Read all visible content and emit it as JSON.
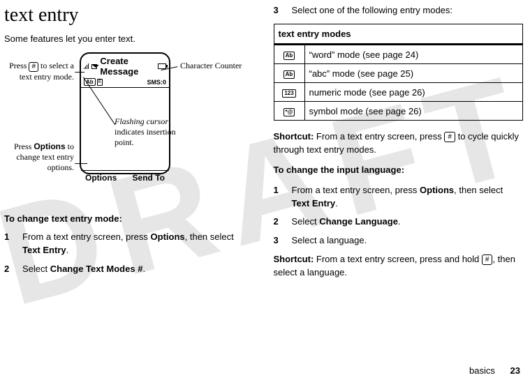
{
  "watermark": "DRAFT",
  "left": {
    "title": "text entry",
    "intro": "Some features let you enter text.",
    "phone": {
      "header": "Create Message",
      "ab_indicator": "Ab",
      "sms": "SMS:0",
      "soft_left": "Options",
      "soft_right": "Send To"
    },
    "annot": {
      "left1_a": "Press ",
      "left1_key": "#",
      "left1_b": " to select a text entry mode.",
      "left2_a": "Press ",
      "left2_options": "Options",
      "left2_b": " to change text entry options.",
      "right1": "Character Counter",
      "right2_ital": "Flashing cursor",
      "right2_rest": " indicates insertion point."
    },
    "change_mode_heading": "To change text entry mode:",
    "step1_a": "From a text entry screen, press ",
    "step1_options": "Options",
    "step1_b": ", then select ",
    "step1_textentry": "Text Entry",
    "step1_c": ".",
    "step2_a": "Select ",
    "step2_changemodes": "Change Text Modes #",
    "step2_b": "."
  },
  "right": {
    "step3": "Select one of the following entry modes:",
    "table_header": "text entry modes",
    "rows": [
      {
        "icon": "Ab",
        "text": "“word” mode (see page 24)"
      },
      {
        "icon": "Ab",
        "text": "“abc” mode (see page 25)"
      },
      {
        "icon": "123",
        "text": "numeric mode (see page 26)"
      },
      {
        "icon": "*@",
        "text": "symbol mode (see page 26)"
      }
    ],
    "shortcut1_a": "Shortcut:",
    "shortcut1_b": " From a text entry screen, press ",
    "shortcut1_key": "#",
    "shortcut1_c": " to cycle quickly through text entry modes.",
    "change_lang_heading": "To change the input language:",
    "lang_step1_a": "From a text entry screen, press ",
    "lang_step1_options": "Options",
    "lang_step1_b": ", then select ",
    "lang_step1_textentry": "Text Entry",
    "lang_step1_c": ".",
    "lang_step2_a": "Select ",
    "lang_step2_cmd": "Change Language",
    "lang_step2_b": ".",
    "lang_step3": "Select a language.",
    "shortcut2_a": "Shortcut:",
    "shortcut2_b": " From a text entry screen, press and hold ",
    "shortcut2_key": "#",
    "shortcut2_c": ", then select a language."
  },
  "footer": {
    "section": "basics",
    "page": "23"
  },
  "step_nums": {
    "n1": "1",
    "n2": "2",
    "n3": "3"
  }
}
